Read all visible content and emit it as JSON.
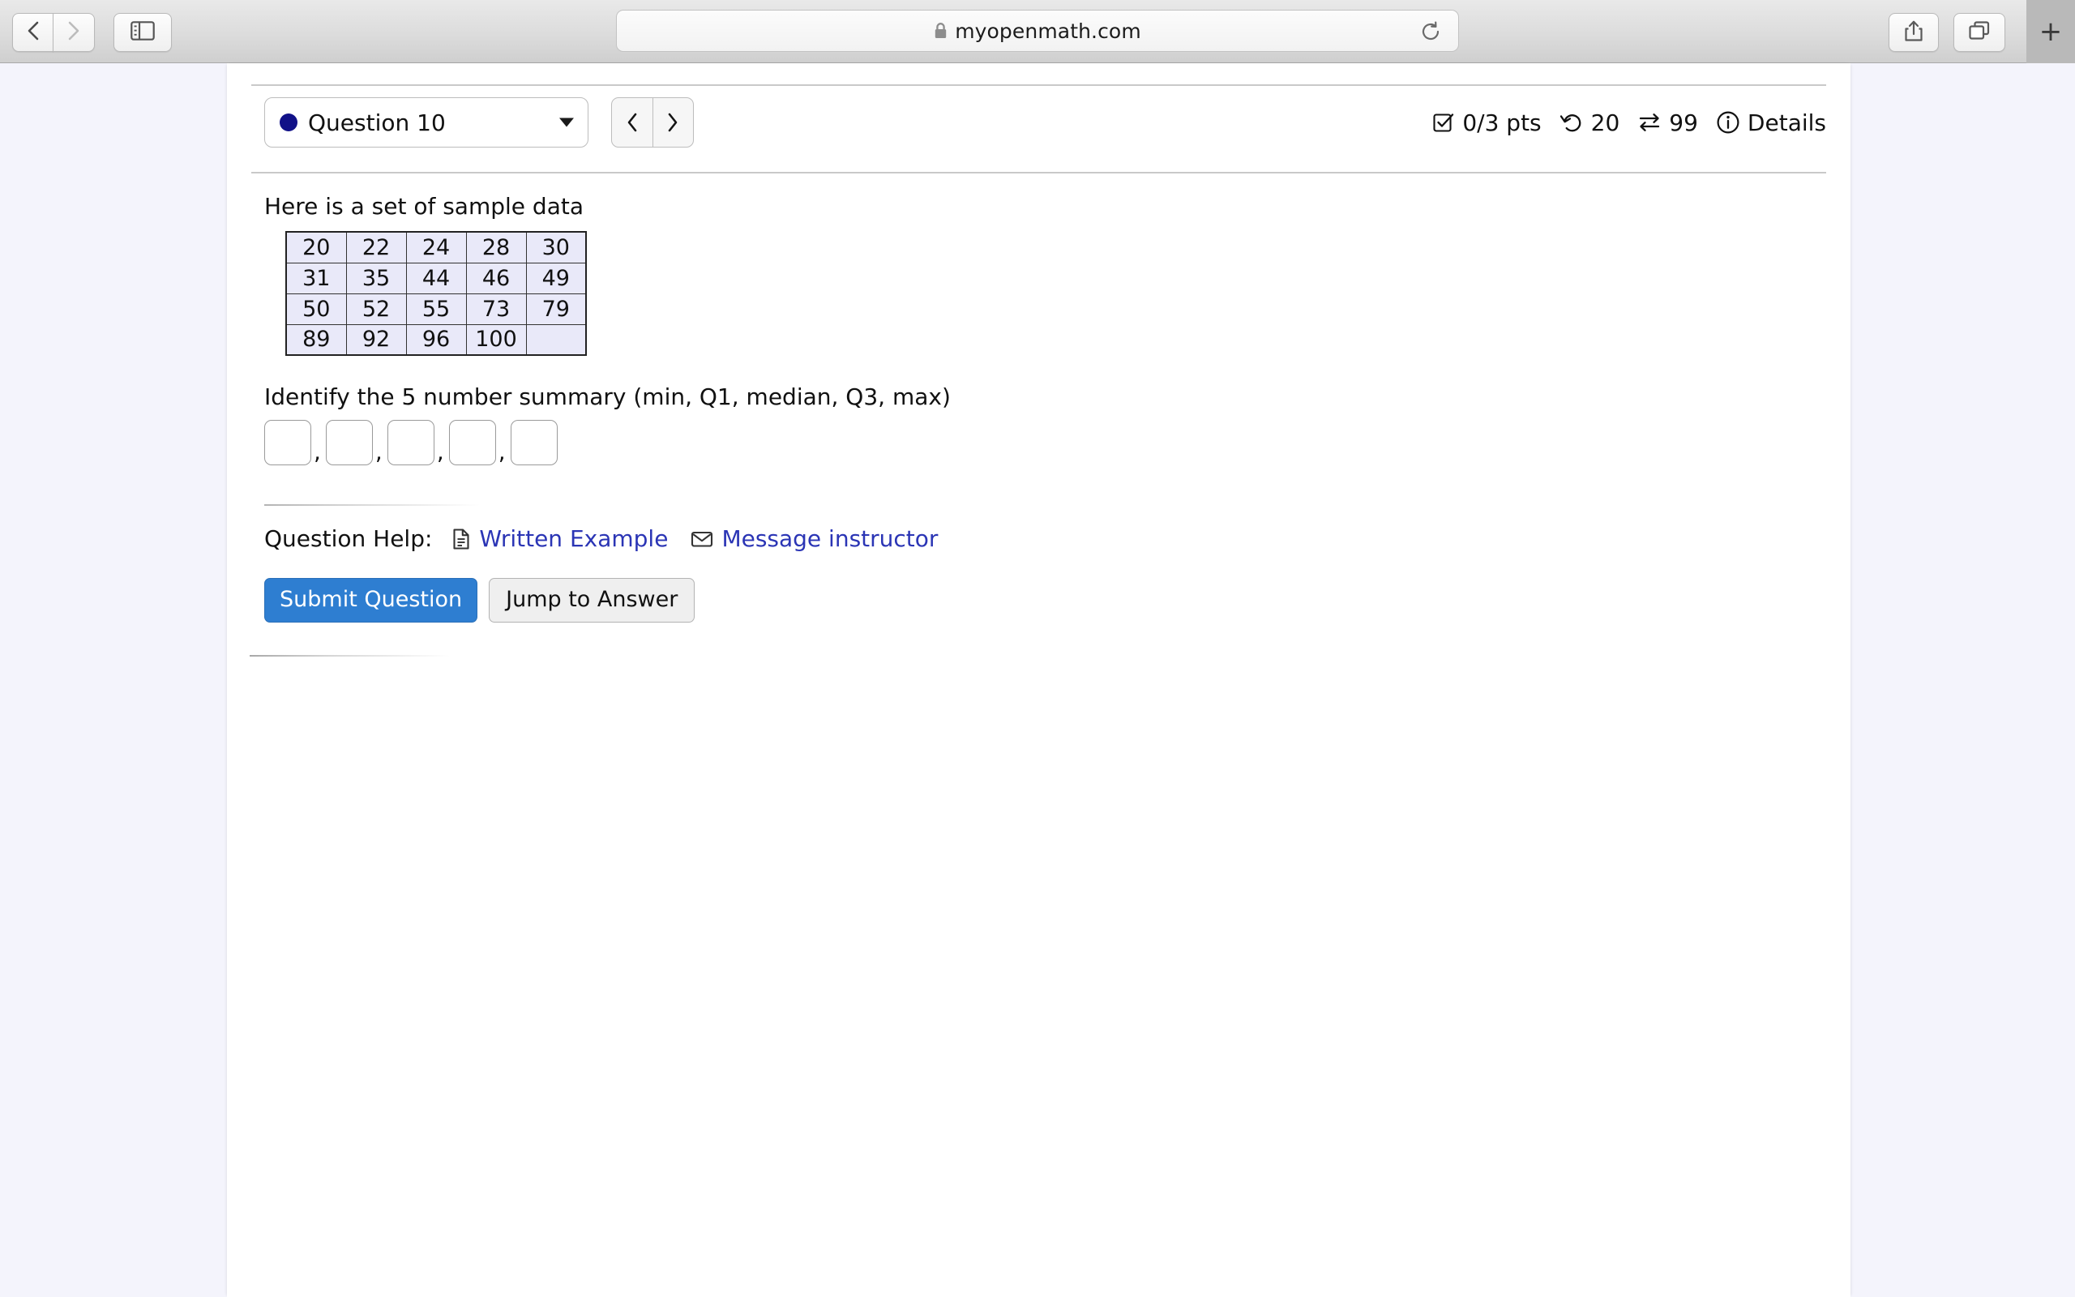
{
  "browser": {
    "back_icon": "chevron-left-icon",
    "forward_icon": "chevron-right-icon",
    "sidebar_icon": "sidebar-toggle-icon",
    "url": "myopenmath.com",
    "lock_icon": "lock-icon",
    "reload_icon": "reload-icon",
    "share_icon": "share-icon",
    "tabs_icon": "tab-overview-icon",
    "new_tab_label": "+"
  },
  "question_header": {
    "selected_question": "Question 10",
    "status_dot_color": "#111188",
    "caret_icon": "chevron-down-icon",
    "prev_icon": "chevron-left-icon",
    "next_icon": "chevron-right-icon",
    "stats": [
      {
        "icon": "checkbox-icon",
        "text": "0/3 pts"
      },
      {
        "icon": "undo-icon",
        "text": "20"
      },
      {
        "icon": "swap-icon",
        "text": "99"
      },
      {
        "icon": "info-icon",
        "text": "Details"
      }
    ]
  },
  "question": {
    "prompt": "Here is a set of sample data",
    "table": {
      "rows": [
        [
          "20",
          "22",
          "24",
          "28",
          "30"
        ],
        [
          "31",
          "35",
          "44",
          "46",
          "49"
        ],
        [
          "50",
          "52",
          "55",
          "73",
          "79"
        ],
        [
          "89",
          "92",
          "96",
          "100",
          ""
        ]
      ]
    },
    "instruction": "Identify the 5 number summary (min, Q1, median, Q3, max)",
    "answers": [
      "",
      "",
      "",
      "",
      ""
    ],
    "separator": ","
  },
  "help": {
    "label": "Question Help:",
    "links": [
      {
        "icon": "document-icon",
        "label": "Written Example"
      },
      {
        "icon": "envelope-icon",
        "label": "Message instructor"
      }
    ],
    "link_color": "#2b35b5"
  },
  "actions": {
    "submit_label": "Submit Question",
    "jump_label": "Jump to Answer",
    "submit_color": "#2e7ed1"
  }
}
